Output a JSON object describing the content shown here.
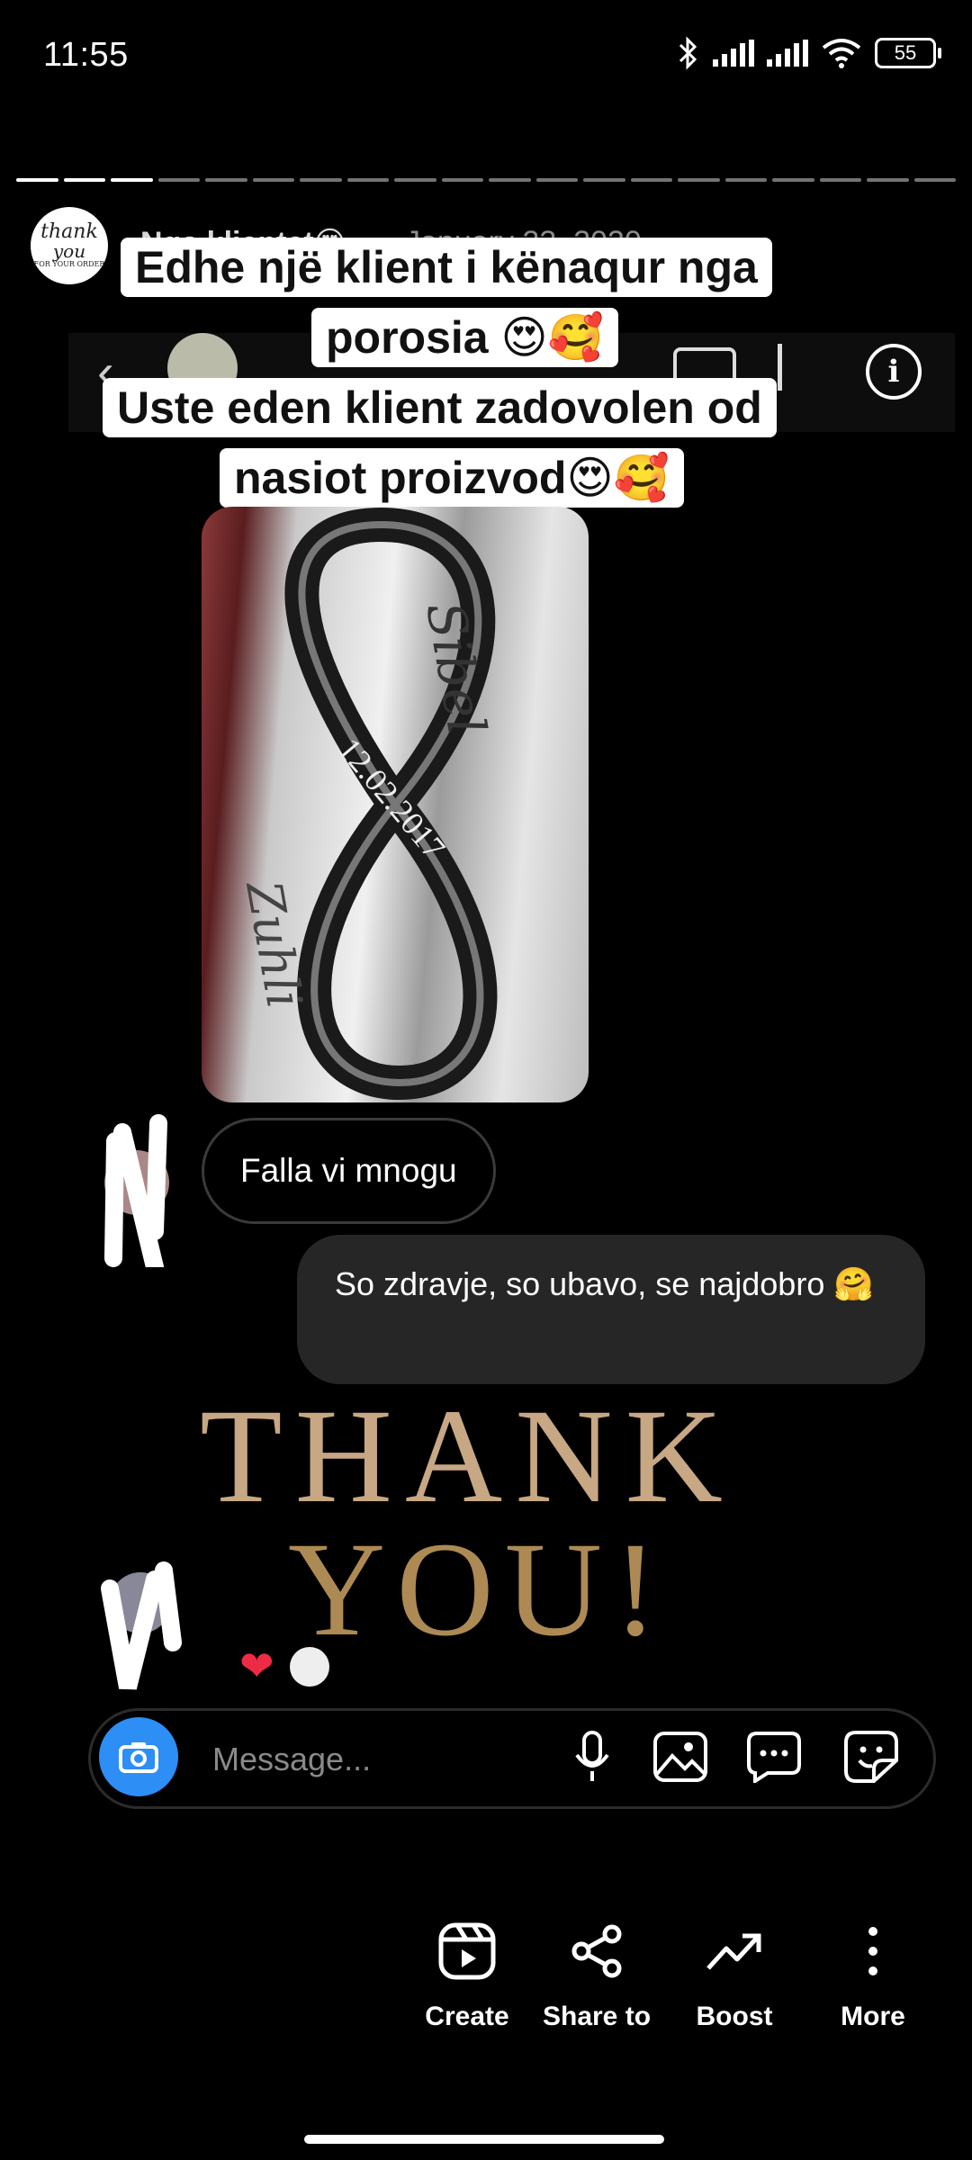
{
  "status_bar": {
    "time": "11:55",
    "battery": "55"
  },
  "story": {
    "avatar_text": [
      "thank",
      "you",
      "FOR YOUR ORDER"
    ],
    "username": "Nga klientet😍",
    "date": "January 23, 2020",
    "progress_segments": 20,
    "progress_done": 3
  },
  "captions": {
    "line1": "Edhe një klient i kënaqur nga",
    "line2": "porosia 😍🥰",
    "line3": "Uste eden klient zadovolen od",
    "line4": "nasiot proizvod😍🥰"
  },
  "product": {
    "engraving_top": "Sibel",
    "engraving_date": "12.02.2017",
    "engraving_bottom": "Zuhli"
  },
  "chat": {
    "incoming": "Falla vi mnogu",
    "outgoing": "So zdravje, so ubavo, se najdobro 🤗",
    "reaction": "❤"
  },
  "thank_you": {
    "line1": "THANK",
    "line2": "YOU!"
  },
  "composer": {
    "placeholder": "Message..."
  },
  "actions": [
    {
      "label": "Create",
      "icon": "reels-icon"
    },
    {
      "label": "Share to",
      "icon": "share-icon"
    },
    {
      "label": "Boost",
      "icon": "trending-up-icon"
    },
    {
      "label": "More",
      "icon": "more-vertical-icon"
    }
  ],
  "colors": {
    "background": "#000000",
    "camera_button": "#2d8ef5",
    "heart": "#ed2b45",
    "thank_you_gold": "#ad8a54"
  }
}
